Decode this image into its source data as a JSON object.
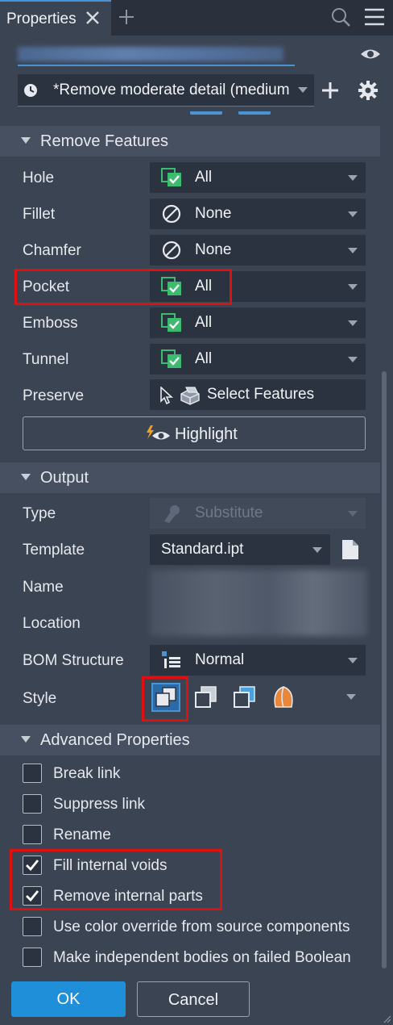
{
  "tab": {
    "title": "Properties"
  },
  "header": {
    "preset": "*Remove moderate detail (medium"
  },
  "remove_features": {
    "title": "Remove Features",
    "rows": [
      {
        "label": "Hole",
        "value": "All",
        "icon": "check-all-icon"
      },
      {
        "label": "Fillet",
        "value": "None",
        "icon": "none-icon"
      },
      {
        "label": "Chamfer",
        "value": "None",
        "icon": "none-icon"
      },
      {
        "label": "Pocket",
        "value": "All",
        "icon": "check-all-icon"
      },
      {
        "label": "Emboss",
        "value": "All",
        "icon": "check-all-icon"
      },
      {
        "label": "Tunnel",
        "value": "All",
        "icon": "check-all-icon"
      }
    ],
    "preserve_label": "Preserve",
    "select_features": "Select Features",
    "highlight": "Highlight"
  },
  "output": {
    "title": "Output",
    "type_label": "Type",
    "type_value": "Substitute",
    "template_label": "Template",
    "template_value": "Standard.ipt",
    "name_label": "Name",
    "location_label": "Location",
    "bom_label": "BOM Structure",
    "bom_value": "Normal",
    "style_label": "Style"
  },
  "advanced": {
    "title": "Advanced Properties",
    "options": [
      {
        "label": "Break link",
        "checked": false
      },
      {
        "label": "Suppress link",
        "checked": false
      },
      {
        "label": "Rename",
        "checked": false
      },
      {
        "label": "Fill internal voids",
        "checked": true
      },
      {
        "label": "Remove internal parts",
        "checked": true
      },
      {
        "label": "Use color override from source components",
        "checked": false
      },
      {
        "label": "Make independent bodies on failed Boolean",
        "checked": false
      }
    ]
  },
  "footer": {
    "ok": "OK",
    "cancel": "Cancel"
  },
  "colors": {
    "accent": "#1f8fd9",
    "highlight_box": "#e01010",
    "check_green": "#3dbb6e"
  }
}
